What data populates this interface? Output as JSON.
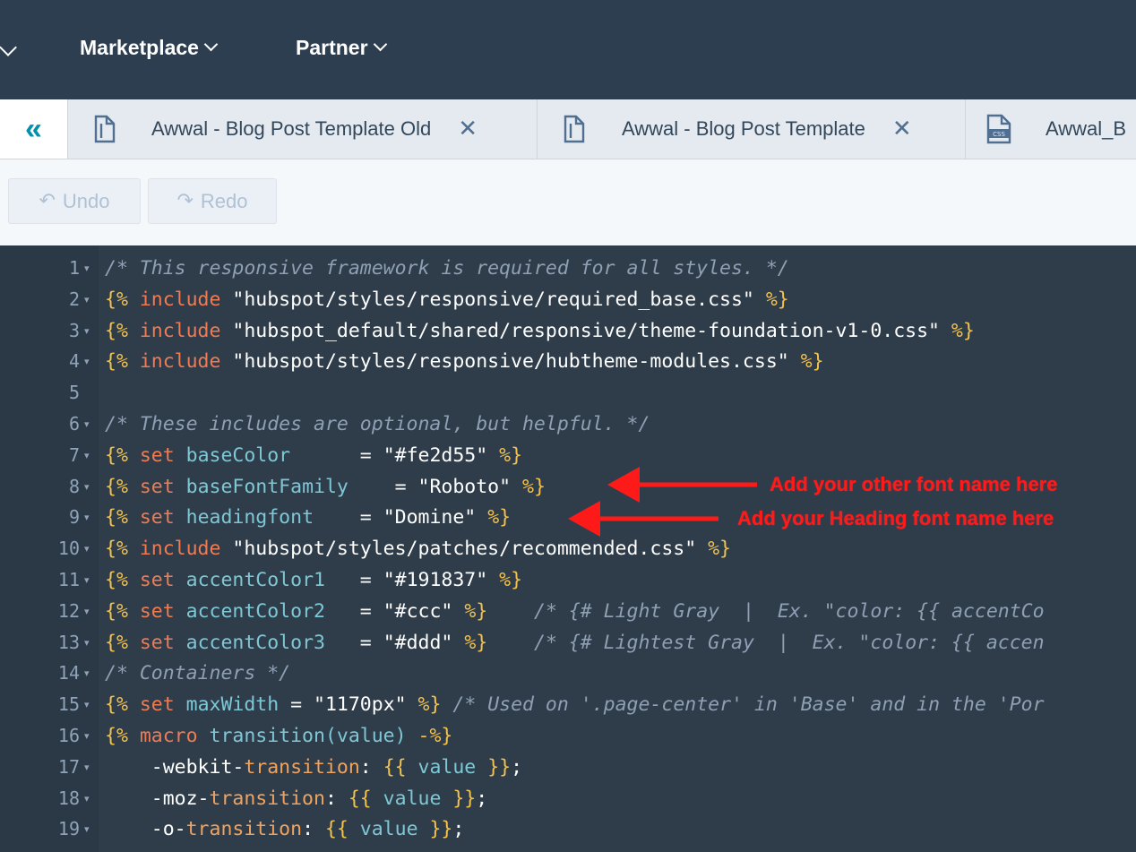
{
  "nav": {
    "items": [
      {
        "label": "Marketplace"
      },
      {
        "label": "Partner"
      }
    ]
  },
  "tabs": {
    "collapse_icon": "double-chevron-left-icon",
    "items": [
      {
        "label": "Awwal - Blog Post Template Old",
        "icon": "file-icon",
        "close": "✕"
      },
      {
        "label": "Awwal - Blog Post Template",
        "icon": "file-icon",
        "close": "✕"
      },
      {
        "label": "Awwal_B",
        "icon": "css-file-icon"
      }
    ]
  },
  "toolbar": {
    "undo_label": "Undo",
    "redo_label": "Redo"
  },
  "editor": {
    "lines": [
      {
        "n": "1",
        "tokens": [
          {
            "t": "/* This responsive framework is required for all styles. */",
            "c": "c"
          }
        ]
      },
      {
        "n": "2",
        "tokens": [
          {
            "t": "{%",
            "c": "b"
          },
          {
            "t": " include ",
            "c": "k"
          },
          {
            "t": "\"hubspot/styles/responsive/required_base.css\"",
            "c": "s"
          },
          {
            "t": " %}",
            "c": "b"
          }
        ]
      },
      {
        "n": "3",
        "tokens": [
          {
            "t": "{%",
            "c": "b"
          },
          {
            "t": " include ",
            "c": "k"
          },
          {
            "t": "\"hubspot_default/shared/responsive/theme-foundation-v1-0.css\"",
            "c": "s"
          },
          {
            "t": " %}",
            "c": "b"
          }
        ]
      },
      {
        "n": "4",
        "tokens": [
          {
            "t": "{%",
            "c": "b"
          },
          {
            "t": " include ",
            "c": "k"
          },
          {
            "t": "\"hubspot/styles/responsive/hubtheme-modules.css\"",
            "c": "s"
          },
          {
            "t": " %}",
            "c": "b"
          }
        ]
      },
      {
        "n": "5",
        "tokens": []
      },
      {
        "n": "6",
        "tokens": [
          {
            "t": "/* These includes are optional, but helpful. */",
            "c": "c"
          }
        ]
      },
      {
        "n": "7",
        "tokens": [
          {
            "t": "{%",
            "c": "b"
          },
          {
            "t": " set ",
            "c": "k"
          },
          {
            "t": "baseColor",
            "c": "v"
          },
          {
            "t": "      = ",
            "c": "p"
          },
          {
            "t": "\"#fe2d55\"",
            "c": "s"
          },
          {
            "t": " %}",
            "c": "b"
          }
        ]
      },
      {
        "n": "8",
        "tokens": [
          {
            "t": "{%",
            "c": "b"
          },
          {
            "t": " set ",
            "c": "k"
          },
          {
            "t": "baseFontFamily",
            "c": "v"
          },
          {
            "t": "    = ",
            "c": "p"
          },
          {
            "t": "\"Roboto\"",
            "c": "s"
          },
          {
            "t": " %}",
            "c": "b"
          }
        ]
      },
      {
        "n": "9",
        "tokens": [
          {
            "t": "{%",
            "c": "b"
          },
          {
            "t": " set ",
            "c": "k"
          },
          {
            "t": "headingfont",
            "c": "v"
          },
          {
            "t": "    = ",
            "c": "p"
          },
          {
            "t": "\"Domine\"",
            "c": "s"
          },
          {
            "t": " %}",
            "c": "b"
          }
        ]
      },
      {
        "n": "10",
        "tokens": [
          {
            "t": "{%",
            "c": "b"
          },
          {
            "t": " include ",
            "c": "k"
          },
          {
            "t": "\"hubspot/styles/patches/recommended.css\"",
            "c": "s"
          },
          {
            "t": " %}",
            "c": "b"
          }
        ]
      },
      {
        "n": "11",
        "tokens": [
          {
            "t": "{%",
            "c": "b"
          },
          {
            "t": " set ",
            "c": "k"
          },
          {
            "t": "accentColor1",
            "c": "v"
          },
          {
            "t": "   = ",
            "c": "p"
          },
          {
            "t": "\"#191837\"",
            "c": "s"
          },
          {
            "t": " %}",
            "c": "b"
          }
        ]
      },
      {
        "n": "12",
        "tokens": [
          {
            "t": "{%",
            "c": "b"
          },
          {
            "t": " set ",
            "c": "k"
          },
          {
            "t": "accentColor2",
            "c": "v"
          },
          {
            "t": "   = ",
            "c": "p"
          },
          {
            "t": "\"#ccc\"",
            "c": "s"
          },
          {
            "t": " %}",
            "c": "b"
          },
          {
            "t": "    /* {# Light Gray  |  Ex. \"color: {{ accentCo",
            "c": "c"
          }
        ]
      },
      {
        "n": "13",
        "tokens": [
          {
            "t": "{%",
            "c": "b"
          },
          {
            "t": " set ",
            "c": "k"
          },
          {
            "t": "accentColor3",
            "c": "v"
          },
          {
            "t": "   = ",
            "c": "p"
          },
          {
            "t": "\"#ddd\"",
            "c": "s"
          },
          {
            "t": " %}",
            "c": "b"
          },
          {
            "t": "    /* {# Lightest Gray  |  Ex. \"color: {{ accen",
            "c": "c"
          }
        ]
      },
      {
        "n": "14",
        "tokens": [
          {
            "t": "/* Containers */",
            "c": "c"
          }
        ]
      },
      {
        "n": "15",
        "tokens": [
          {
            "t": "{%",
            "c": "b"
          },
          {
            "t": " set ",
            "c": "k"
          },
          {
            "t": "maxWidth",
            "c": "v"
          },
          {
            "t": " = ",
            "c": "p"
          },
          {
            "t": "\"1170px\"",
            "c": "s"
          },
          {
            "t": " %}",
            "c": "b"
          },
          {
            "t": " /* Used on '.page-center' in 'Base' and in the 'Por",
            "c": "c"
          }
        ]
      },
      {
        "n": "16",
        "tokens": [
          {
            "t": "{%",
            "c": "b"
          },
          {
            "t": " macro ",
            "c": "k"
          },
          {
            "t": "transition(value)",
            "c": "v"
          },
          {
            "t": " -%}",
            "c": "b"
          }
        ]
      },
      {
        "n": "17",
        "tokens": [
          {
            "t": "    -webkit-",
            "c": "p"
          },
          {
            "t": "transition",
            "c": "f"
          },
          {
            "t": ": ",
            "c": "p"
          },
          {
            "t": "{{",
            "c": "b"
          },
          {
            "t": " value ",
            "c": "v"
          },
          {
            "t": "}}",
            "c": "b"
          },
          {
            "t": ";",
            "c": "p"
          }
        ]
      },
      {
        "n": "18",
        "tokens": [
          {
            "t": "    -moz-",
            "c": "p"
          },
          {
            "t": "transition",
            "c": "f"
          },
          {
            "t": ": ",
            "c": "p"
          },
          {
            "t": "{{",
            "c": "b"
          },
          {
            "t": " value ",
            "c": "v"
          },
          {
            "t": "}}",
            "c": "b"
          },
          {
            "t": ";",
            "c": "p"
          }
        ]
      },
      {
        "n": "19",
        "tokens": [
          {
            "t": "    -o-",
            "c": "p"
          },
          {
            "t": "transition",
            "c": "f"
          },
          {
            "t": ": ",
            "c": "p"
          },
          {
            "t": "{{",
            "c": "b"
          },
          {
            "t": " value ",
            "c": "v"
          },
          {
            "t": "}}",
            "c": "b"
          },
          {
            "t": ";",
            "c": "p"
          }
        ]
      }
    ],
    "fold_icon": "fold-arrow-icon",
    "fold_glyph": "▾"
  },
  "annotations": [
    {
      "text": "Add your other font name here",
      "color": "#ff1a1a"
    },
    {
      "text": "Add your Heading font name here",
      "color": "#ff1a1a"
    }
  ]
}
